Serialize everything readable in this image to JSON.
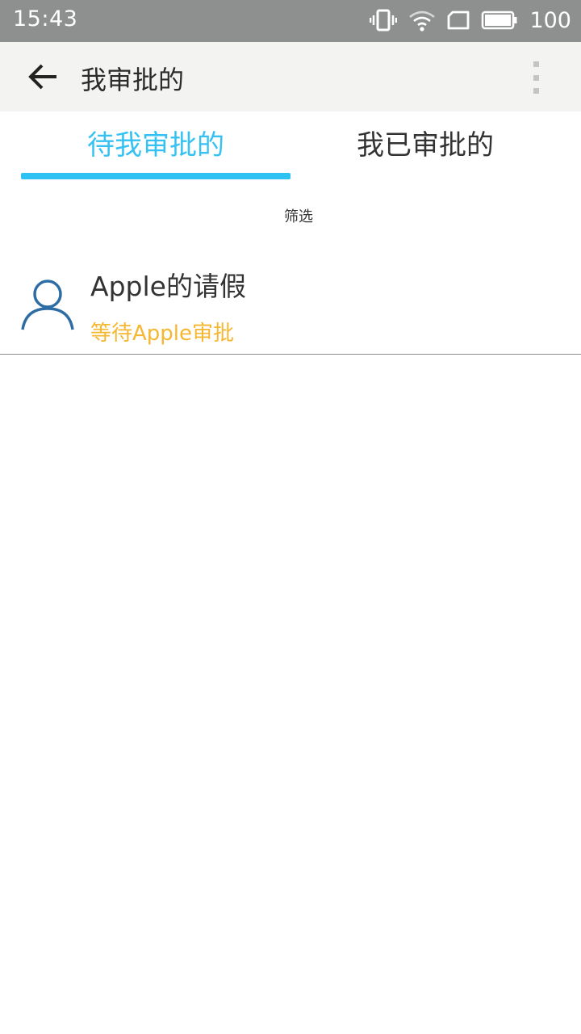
{
  "status_bar": {
    "time": "15:43",
    "battery_percent": "100",
    "icons": [
      "vibrate-icon",
      "wifi-icon",
      "sim-icon",
      "battery-icon"
    ]
  },
  "app_bar": {
    "title": "我审批的",
    "back_icon": "arrow-left-icon",
    "overflow_icon": "more-vertical-icon"
  },
  "tabs": [
    {
      "label": "待我审批的",
      "selected": true
    },
    {
      "label": "我已审批的",
      "selected": false
    }
  ],
  "filter": {
    "label": "筛选"
  },
  "list": {
    "items": [
      {
        "title": "Apple的请假",
        "status": "等待Apple审批",
        "icon": "user-icon"
      }
    ]
  },
  "colors": {
    "status_bar": "#8e8f8f",
    "app_bar": "#f3f3f1",
    "accent": "#2ec1f3",
    "pending_status": "#f5b730",
    "avatar": "#2e6da4"
  }
}
